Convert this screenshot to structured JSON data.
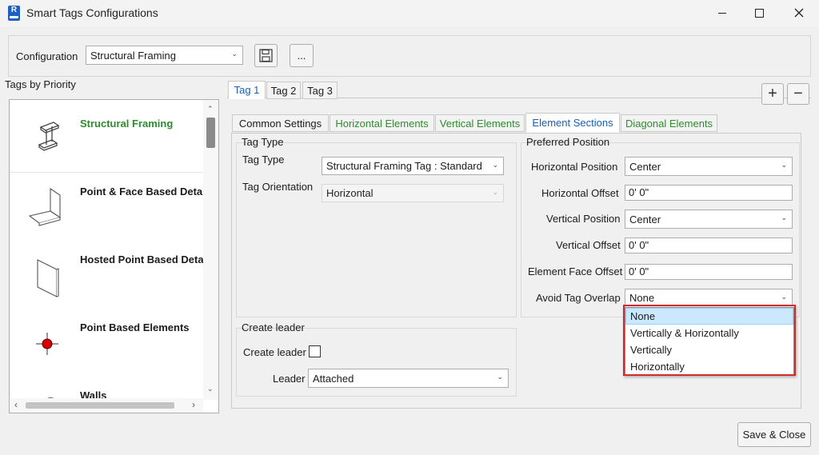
{
  "window": {
    "title": "Smart Tags Configurations",
    "app_icon_letter": "R"
  },
  "config": {
    "label": "Configuration",
    "value": "Structural Framing",
    "more_label": "..."
  },
  "left": {
    "header": "Tags by Priority",
    "items": [
      {
        "label": "Structural Framing",
        "icon": "steel-beam-icon"
      },
      {
        "label": "Point & Face Based Detai",
        "icon": "face-based-element-icon"
      },
      {
        "label": "Hosted Point Based Detai",
        "icon": "hosted-panel-icon"
      },
      {
        "label": "Point Based Elements",
        "icon": "point-marker-icon"
      },
      {
        "label": "Walls",
        "icon": "wall-icon"
      }
    ]
  },
  "tag_tabs": [
    "Tag 1",
    "Tag 2",
    "Tag 3"
  ],
  "section_tabs": [
    "Common Settings",
    "Horizontal Elements",
    "Vertical Elements",
    "Element Sections",
    "Diagonal Elements"
  ],
  "tag_type_group": {
    "title": "Tag Type",
    "type_label": "Tag Type",
    "type_value": "Structural Framing Tag : Standard",
    "orientation_label": "Tag Orientation",
    "orientation_value": "Horizontal"
  },
  "leader_group": {
    "title": "Create leader",
    "create_label": "Create leader",
    "leader_label": "Leader",
    "leader_value": "Attached"
  },
  "position_group": {
    "title": "Preferred Position",
    "h_pos_label": "Horizontal Position",
    "h_pos_value": "Center",
    "h_off_label": "Horizontal Offset",
    "h_off_value": "0'  0\"",
    "v_pos_label": "Vertical Position",
    "v_pos_value": "Center",
    "v_off_label": "Vertical Offset",
    "v_off_value": "0'  0\"",
    "face_off_label": "Element Face Offset",
    "face_off_value": "0'  0\"",
    "avoid_label": "Avoid Tag Overlap",
    "avoid_value": "None"
  },
  "avoid_options": [
    "None",
    "Vertically & Horizontally",
    "Vertically",
    "Horizontally"
  ],
  "buttons": {
    "plus": "+",
    "minus": "−",
    "save_close": "Save & Close"
  },
  "colors": {
    "active_green": "#2e8b2e",
    "tab_blue": "#1a5fb4",
    "highlight_frame": "#d42a2a",
    "selection_blue": "#cce8ff"
  }
}
